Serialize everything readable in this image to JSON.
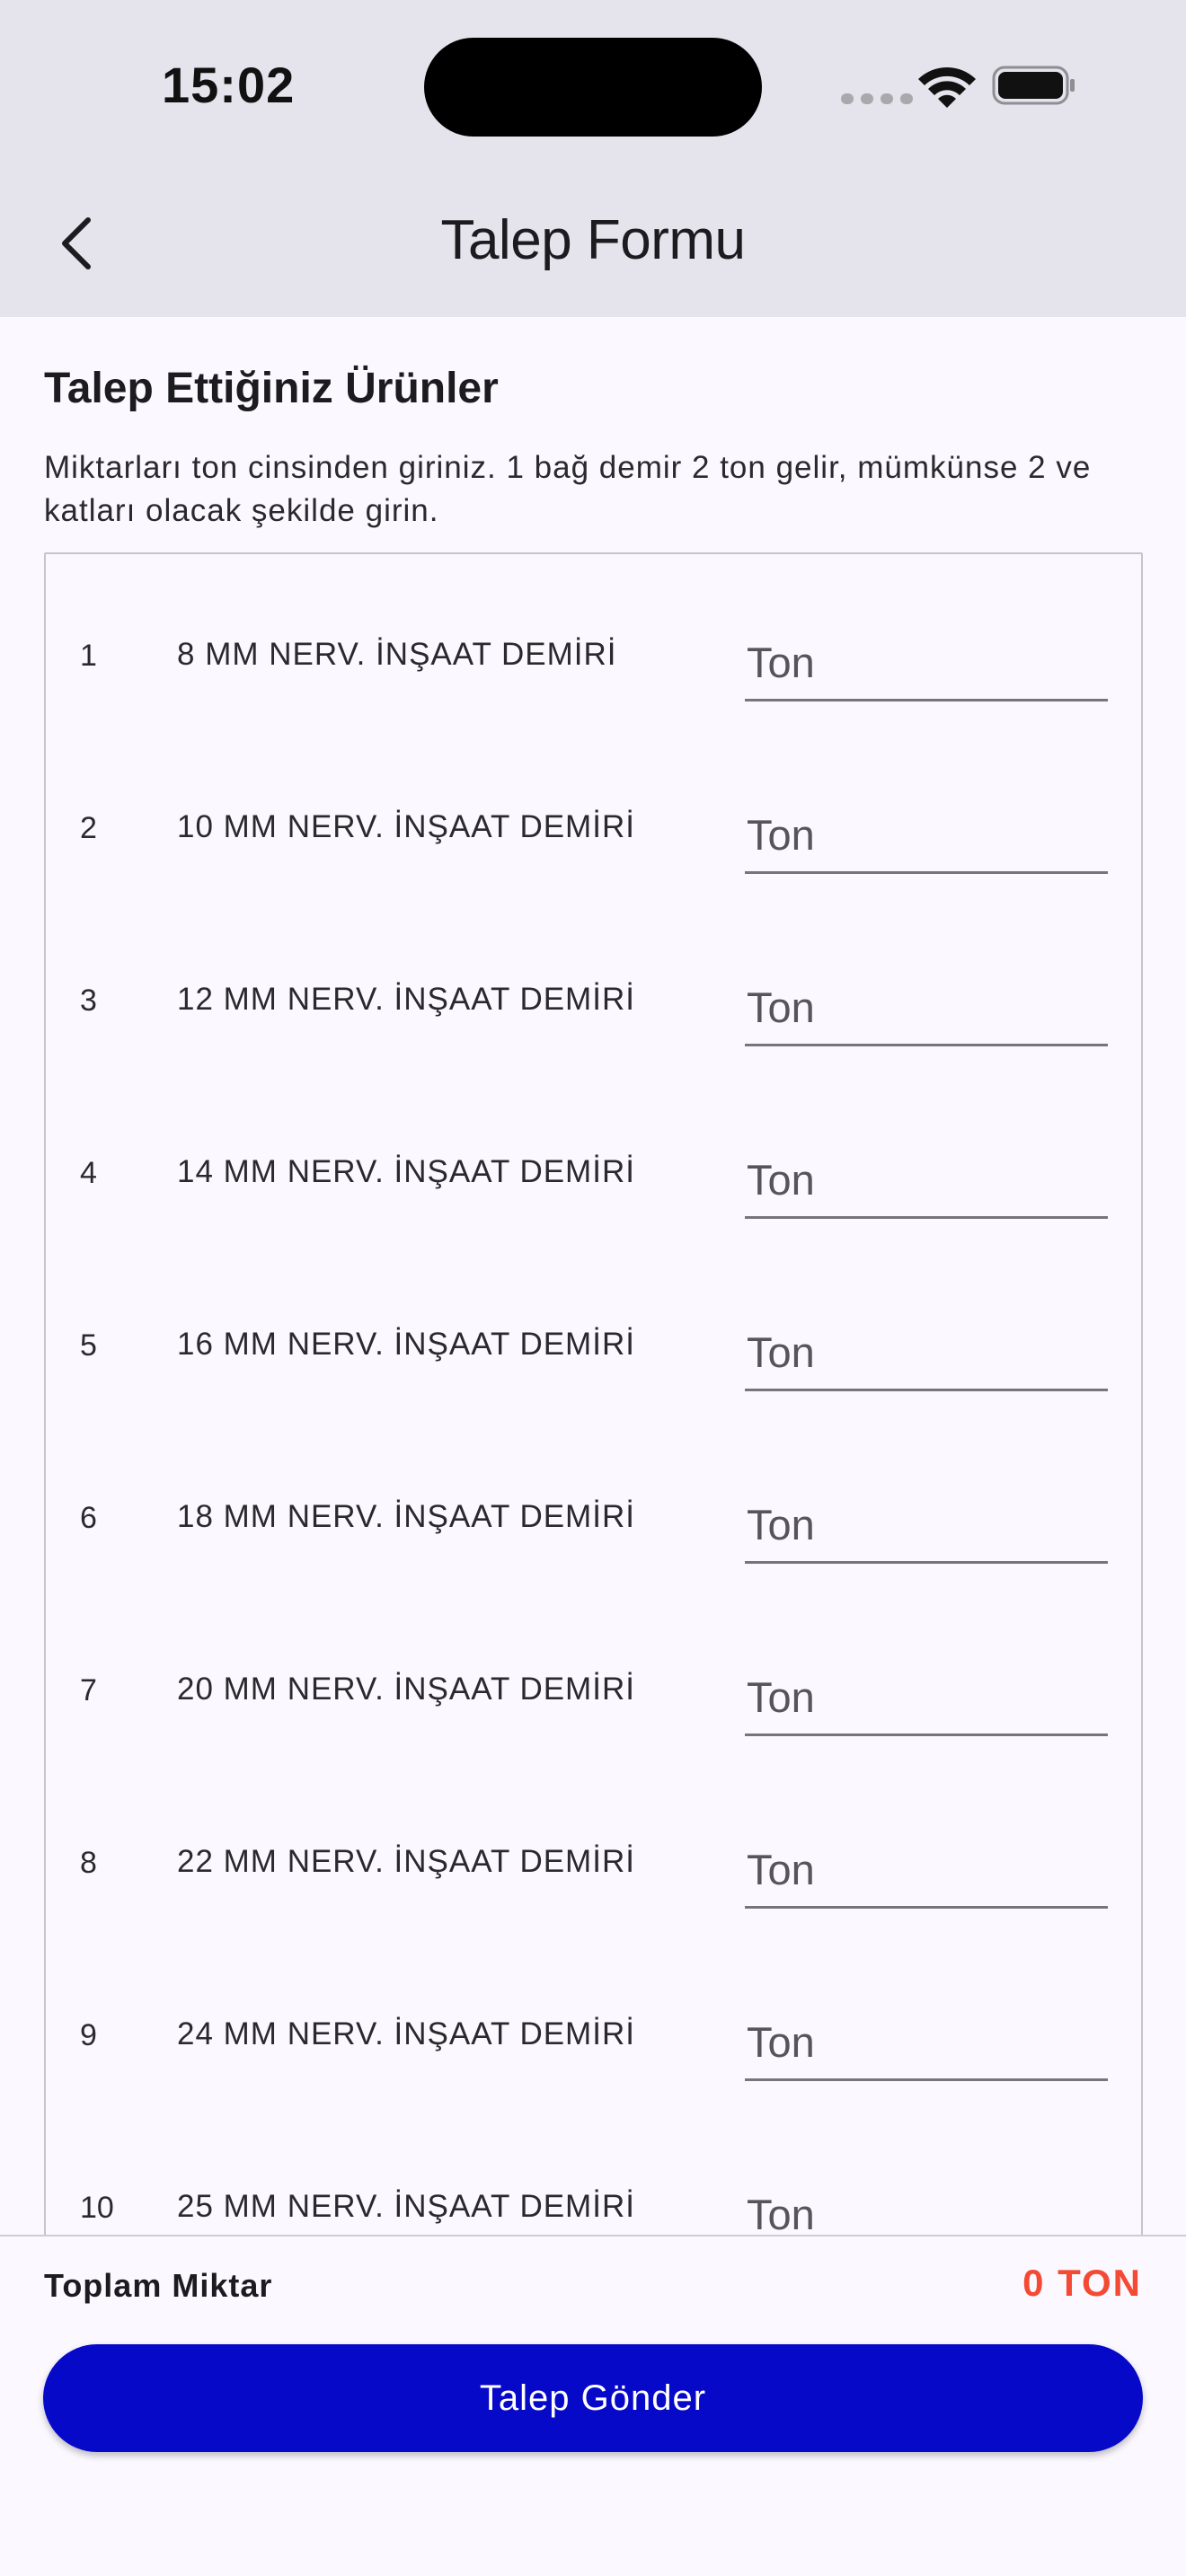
{
  "status_bar": {
    "time": "15:02"
  },
  "app_bar": {
    "title": "Talep Formu",
    "back_icon": "chevron-left-icon"
  },
  "section": {
    "title": "Talep Ettiğiniz Ürünler",
    "description": "Miktarları ton cinsinden giriniz. 1 bağ demir 2 ton gelir, mümkünse 2 ve katları olacak şekilde girin."
  },
  "products": [
    {
      "num": "1",
      "name": "8 MM NERV. İNŞAAT DEMİRİ",
      "placeholder": "Ton"
    },
    {
      "num": "2",
      "name": "10 MM NERV. İNŞAAT DEMİRİ",
      "placeholder": "Ton"
    },
    {
      "num": "3",
      "name": "12 MM NERV. İNŞAAT DEMİRİ",
      "placeholder": "Ton"
    },
    {
      "num": "4",
      "name": "14 MM NERV. İNŞAAT DEMİRİ",
      "placeholder": "Ton"
    },
    {
      "num": "5",
      "name": "16 MM NERV. İNŞAAT DEMİRİ",
      "placeholder": "Ton"
    },
    {
      "num": "6",
      "name": "18 MM NERV. İNŞAAT DEMİRİ",
      "placeholder": "Ton"
    },
    {
      "num": "7",
      "name": "20 MM NERV. İNŞAAT DEMİRİ",
      "placeholder": "Ton"
    },
    {
      "num": "8",
      "name": "22 MM NERV. İNŞAAT DEMİRİ",
      "placeholder": "Ton"
    },
    {
      "num": "9",
      "name": "24 MM NERV. İNŞAAT DEMİRİ",
      "placeholder": "Ton"
    },
    {
      "num": "10",
      "name": "25 MM NERV. İNŞAAT DEMİRİ",
      "placeholder": "Ton"
    }
  ],
  "footer": {
    "total_label": "Toplam Miktar",
    "total_value": "0 TON",
    "submit_label": "Talep Gönder"
  },
  "colors": {
    "primary_button": "#0709c9",
    "total_value": "#f44a34",
    "top_bar": "#e5e3eb",
    "background": "#fbf8ff"
  }
}
